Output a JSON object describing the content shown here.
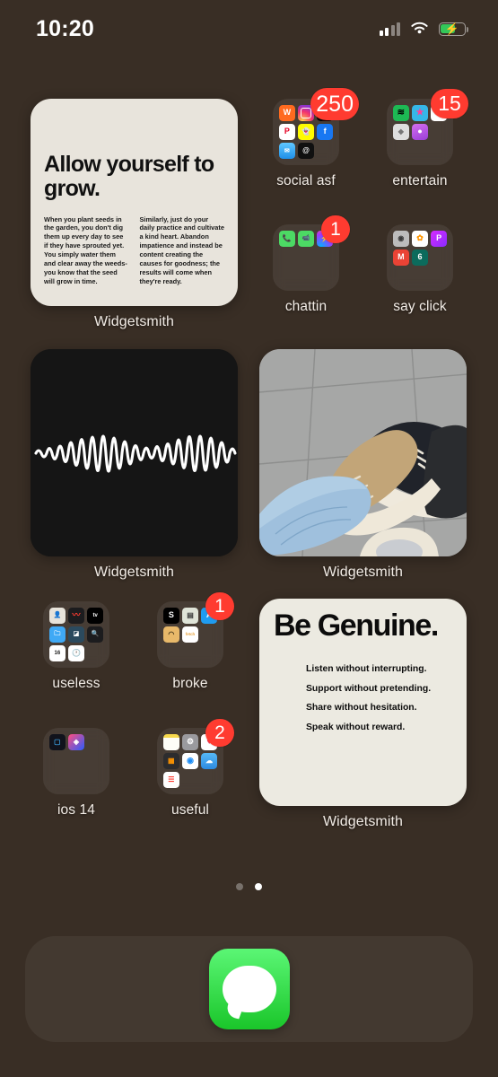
{
  "status_bar": {
    "time": "10:20",
    "signal_icon": "cellular-signal-icon",
    "wifi_icon": "wifi-icon",
    "battery_icon": "battery-charging-icon",
    "battery_charging": true
  },
  "theme": {
    "background": "#392e25",
    "label_color": "#f2ece6",
    "badge_color": "#ff3b30",
    "dot_active": "#ffffff"
  },
  "home_screen": {
    "rows": [
      {
        "widgets": [
          {
            "name": "widget-allow-yourself-to-grow",
            "app": "Widgetsmith",
            "label": "Widgetsmith",
            "type": "quote-image",
            "heading": "Allow yourself to grow.",
            "body_left": "When you plant seeds in the garden, you don't dig them up every day to see if they have sprouted yet. You simply water them and clear away the weeds- you know that the seed will grow in time.",
            "body_right": "Similarly, just do your daily practice and cultivate a kind heart. Abandon impatience and instead be content creating the causes for goodness; the results will come when they're ready."
          }
        ],
        "folders": [
          {
            "name": "folder-social-asf",
            "label": "social asf",
            "badge": "250",
            "apps": [
              {
                "name": "wattpad-icon",
                "glyph": "W",
                "bg": "#ff6a1f",
                "fg": "#ffffff"
              },
              {
                "name": "instagram-icon",
                "glyph": "",
                "bg": "instagram",
                "fg": "#ffffff"
              },
              {
                "name": "tiktok-icon",
                "glyph": "♪",
                "bg": "#000000",
                "fg": "#ffffff"
              },
              {
                "name": "pinterest-icon",
                "glyph": "P",
                "bg": "#ffffff",
                "fg": "#e60023"
              },
              {
                "name": "snapchat-icon",
                "glyph": "👻",
                "bg": "#fffc00",
                "fg": "#ffffff"
              },
              {
                "name": "facebook-icon",
                "glyph": "f",
                "bg": "#1877f2",
                "fg": "#ffffff"
              },
              {
                "name": "mail-icon",
                "glyph": "✉",
                "bg": "#41b3ff",
                "fg": "#ffffff"
              },
              {
                "name": "threads-icon",
                "glyph": "@",
                "bg": "#111111",
                "fg": "#ffffff"
              }
            ]
          },
          {
            "name": "folder-entertain",
            "label": "entertain",
            "badge": "15",
            "apps": [
              {
                "name": "spotify-icon",
                "glyph": "≋",
                "bg": "#1db954",
                "fg": "#000000"
              },
              {
                "name": "disney-star-icon",
                "glyph": "★",
                "bg": "#35b7e8",
                "fg": "#ff3e9a"
              },
              {
                "name": "youtube-icon",
                "glyph": "▶",
                "bg": "#ffffff",
                "fg": "#ff0000"
              },
              {
                "name": "roblox-icon",
                "glyph": "◆",
                "bg": "#e8e8e8",
                "fg": "#6b6b6b"
              },
              {
                "name": "podcasts-icon",
                "glyph": "⏺",
                "bg": "#b44bdd",
                "fg": "#ffffff"
              }
            ]
          }
        ]
      },
      {
        "folders": [
          {
            "name": "folder-chattin",
            "label": "chattin",
            "badge": "1",
            "apps": [
              {
                "name": "phone-icon",
                "glyph": "📞",
                "bg": "#4cd964",
                "fg": "#ffffff"
              },
              {
                "name": "facetime-icon",
                "glyph": "📹",
                "bg": "#4cd964",
                "fg": "#ffffff"
              },
              {
                "name": "messenger-icon",
                "glyph": "⚡",
                "bg": "messenger",
                "fg": "#ffffff"
              }
            ]
          },
          {
            "name": "folder-say-click",
            "label": "say click",
            "badge": "",
            "apps": [
              {
                "name": "camera-icon",
                "glyph": "◉",
                "bg": "#b9b9b9",
                "fg": "#3a3a3a"
              },
              {
                "name": "photos-icon",
                "glyph": "✿",
                "bg": "#ffffff",
                "fg": "#ff9500"
              },
              {
                "name": "picsart-icon",
                "glyph": "P",
                "bg": "picsart",
                "fg": "#ffffff"
              },
              {
                "name": "gmail-icon",
                "glyph": "M",
                "bg": "#ea4335",
                "fg": "#ffffff"
              },
              {
                "name": "b612-icon",
                "glyph": "6",
                "bg": "#0c6b5c",
                "fg": "#ffffff"
              }
            ]
          }
        ]
      },
      {
        "widgets": [
          {
            "name": "widget-waveform-am",
            "app": "Widgetsmith",
            "label": "Widgetsmith",
            "type": "waveform-image"
          },
          {
            "name": "widget-sneakers-photo",
            "app": "Widgetsmith",
            "label": "Widgetsmith",
            "type": "photo"
          }
        ]
      },
      {
        "folders": [
          {
            "name": "folder-useless",
            "label": "useless",
            "badge": "",
            "apps": [
              {
                "name": "contacts-icon",
                "glyph": "👤",
                "bg": "#e7e3da",
                "fg": "#8c8c8c"
              },
              {
                "name": "voice-memos-icon",
                "glyph": "〰",
                "bg": "#1c1c1e",
                "fg": "#ff3b30"
              },
              {
                "name": "apple-tv-icon",
                "glyph": "tv",
                "bg": "#000000",
                "fg": "#ffffff"
              },
              {
                "name": "files-icon",
                "glyph": "🗀",
                "bg": "#3fa9f5",
                "fg": "#ffffff"
              },
              {
                "name": "shortcuts-icon",
                "glyph": "◪",
                "bg": "#2b4a5e",
                "fg": "#ffffff"
              },
              {
                "name": "magnifier-icon",
                "glyph": "🔍",
                "bg": "#1c1c1e",
                "fg": "#ffcc00"
              },
              {
                "name": "calendar-icon",
                "glyph": "16",
                "bg": "#ffffff",
                "fg": "#1a1a1a"
              },
              {
                "name": "clock-icon",
                "glyph": "🕐",
                "bg": "#ffffff",
                "fg": "#111111"
              }
            ]
          },
          {
            "name": "folder-broke",
            "label": "broke",
            "badge": "1",
            "apps": [
              {
                "name": "shein-icon",
                "glyph": "S",
                "bg": "#000000",
                "fg": "#ffffff"
              },
              {
                "name": "wallet-icon",
                "glyph": "▤",
                "bg": "#dfe4d8",
                "fg": "#3a3a3a"
              },
              {
                "name": "app-store-icon",
                "glyph": "A",
                "bg": "#1f9cf0",
                "fg": "#ffffff"
              },
              {
                "name": "temu-icon",
                "glyph": "◠",
                "bg": "#e8b96a",
                "fg": "#4a3b1c"
              },
              {
                "name": "fetch-icon",
                "glyph": "fetch",
                "bg": "#ffffff",
                "fg": "#e8a33d"
              }
            ]
          }
        ],
        "widgets": [
          {
            "name": "widget-be-genuine",
            "app": "Widgetsmith",
            "label": "Widgetsmith",
            "type": "quote-image",
            "heading": "Be Genuine.",
            "lines": [
              "Listen without interrupting.",
              "Support without pretending.",
              "Share without hesitation.",
              "Speak without reward."
            ]
          }
        ]
      },
      {
        "folders": [
          {
            "name": "folder-ios-14",
            "label": "ios 14",
            "badge": "",
            "apps": [
              {
                "name": "widgetsmith-icon",
                "glyph": "▢",
                "bg": "#11131c",
                "fg": "#3a9ad9"
              },
              {
                "name": "color-widgets-icon",
                "glyph": "◈",
                "bg": "colorwidgets",
                "fg": "#ffffff"
              }
            ]
          },
          {
            "name": "folder-useful",
            "label": "useful",
            "badge": "2",
            "apps": [
              {
                "name": "notes-icon",
                "glyph": "▤",
                "bg": "#fdfdf7",
                "fg": "#f5c518"
              },
              {
                "name": "settings-icon",
                "glyph": "⚙",
                "bg": "#9a9a9e",
                "fg": "#ffffff"
              },
              {
                "name": "health-icon",
                "glyph": "♥",
                "bg": "#ffffff",
                "fg": "#fc3158"
              },
              {
                "name": "calculator-icon",
                "glyph": "▦",
                "bg": "#2c2c2e",
                "fg": "#ff9500"
              },
              {
                "name": "safari-icon",
                "glyph": "◉",
                "bg": "#ffffff",
                "fg": "#1b8cf5"
              },
              {
                "name": "weather-icon",
                "glyph": "☁",
                "bg": "#47b7f5",
                "fg": "#ffffff"
              },
              {
                "name": "reminders-icon",
                "glyph": "☰",
                "bg": "#ffffff",
                "fg": "#ff3b30"
              }
            ]
          }
        ]
      }
    ],
    "page_dots": {
      "count": 2,
      "active_index": 1
    },
    "dock": {
      "name": "dock",
      "apps": [
        {
          "name": "messages-icon",
          "label": "Messages",
          "color": "#2dd437"
        }
      ]
    }
  }
}
